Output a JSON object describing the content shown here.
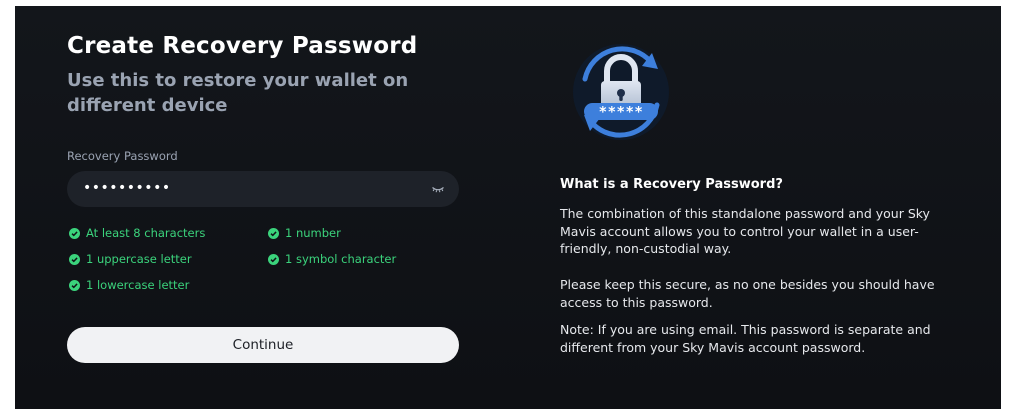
{
  "form": {
    "title": "Create Recovery Password",
    "subtitle": "Use this to restore your wallet on different device",
    "field_label": "Recovery Password",
    "password_masked": "••••••••••",
    "requirements": [
      {
        "label": "At least 8 characters",
        "met": true
      },
      {
        "label": "1 number",
        "met": true
      },
      {
        "label": "1 uppercase letter",
        "met": true
      },
      {
        "label": "1 symbol character",
        "met": true
      },
      {
        "label": "1 lowercase letter",
        "met": true
      }
    ],
    "continue_label": "Continue"
  },
  "illustration": {
    "password_stars": "*****"
  },
  "info": {
    "title": "What is a Recovery Password?",
    "paragraph1": "The combination of this standalone password and your Sky Mavis account allows you to control your wallet in a user-friendly, non-custodial way.",
    "paragraph2": "Please keep this secure, as no one besides you should have access to this password.",
    "paragraph3": "Note: If you are using email. This password is separate and different from your Sky Mavis account password."
  },
  "colors": {
    "background": "#101317",
    "success": "#3bd37c",
    "accent": "#3d7fdc"
  }
}
